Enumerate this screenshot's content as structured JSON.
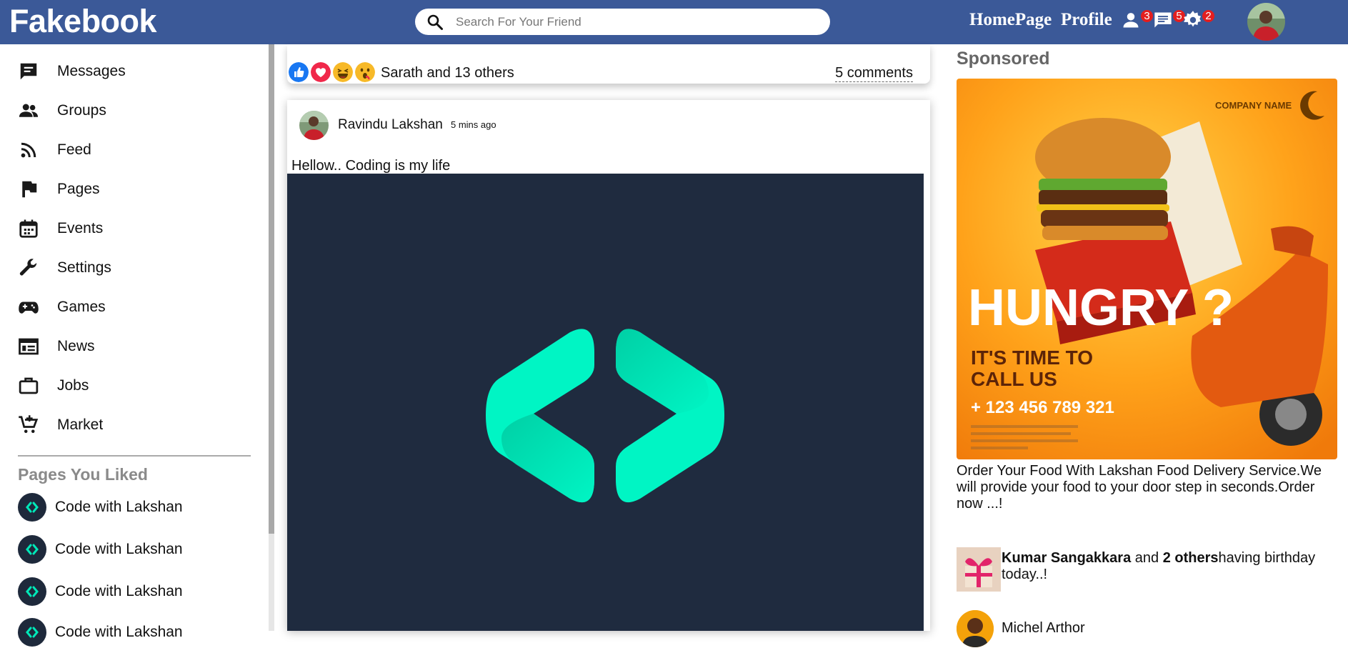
{
  "app": {
    "title": "Fakebook"
  },
  "header": {
    "search_placeholder": "Search For Your Friend",
    "nav": {
      "home": "HomePage",
      "profile": "Profile"
    },
    "badges": {
      "friends": "3",
      "messages": "5",
      "notifications": "2"
    },
    "colors": {
      "bar": "#3b5998",
      "badge": "#e41e1e"
    }
  },
  "sidebar": {
    "items": [
      {
        "label": "Messages",
        "icon": "messages-icon"
      },
      {
        "label": "Groups",
        "icon": "groups-icon"
      },
      {
        "label": "Feed",
        "icon": "rss-feed-icon"
      },
      {
        "label": "Pages",
        "icon": "flag-icon"
      },
      {
        "label": "Events",
        "icon": "calendar-icon"
      },
      {
        "label": "Settings",
        "icon": "wrench-icon"
      },
      {
        "label": "Games",
        "icon": "gamepad-icon"
      },
      {
        "label": "News",
        "icon": "news-icon"
      },
      {
        "label": "Jobs",
        "icon": "briefcase-icon"
      },
      {
        "label": "Market",
        "icon": "cart-icon"
      }
    ],
    "liked_heading": "Pages You Liked",
    "liked_pages": [
      {
        "label": "Code with Lakshan"
      },
      {
        "label": "Code with Lakshan"
      },
      {
        "label": "Code with Lakshan"
      },
      {
        "label": "Code with Lakshan"
      }
    ]
  },
  "feed": {
    "previous_post": {
      "reactions": [
        "like-icon",
        "love-icon",
        "haha-icon",
        "wow-icon"
      ],
      "likers": "Sarath and 13 others",
      "comments": "5 comments"
    },
    "post": {
      "author": "Ravindu Lakshan",
      "time": "5 mins ago",
      "text": "Hellow.. Coding is my life",
      "image": "code-logo-icon",
      "image_bg": "#1f2b3f",
      "logo_color": "#00f5c4"
    }
  },
  "right": {
    "sponsored_heading": "Sponsored",
    "ad": {
      "company": "COMPANY NAME",
      "headline": "HUNGRY ?",
      "sub1": "IT'S TIME TO",
      "sub2": "CALL US",
      "phone": "+ 123 456 789 321",
      "description": "Order Your Food With Lakshan Food Delivery Service.We will provide your food to your door step in seconds.Order now ...!"
    },
    "birthday": {
      "name": "Kumar Sangakkara",
      "connector": " and ",
      "others": "2 others",
      "suffix": "having birthday today..!"
    },
    "friend": {
      "name": "Michel Arthor"
    }
  }
}
